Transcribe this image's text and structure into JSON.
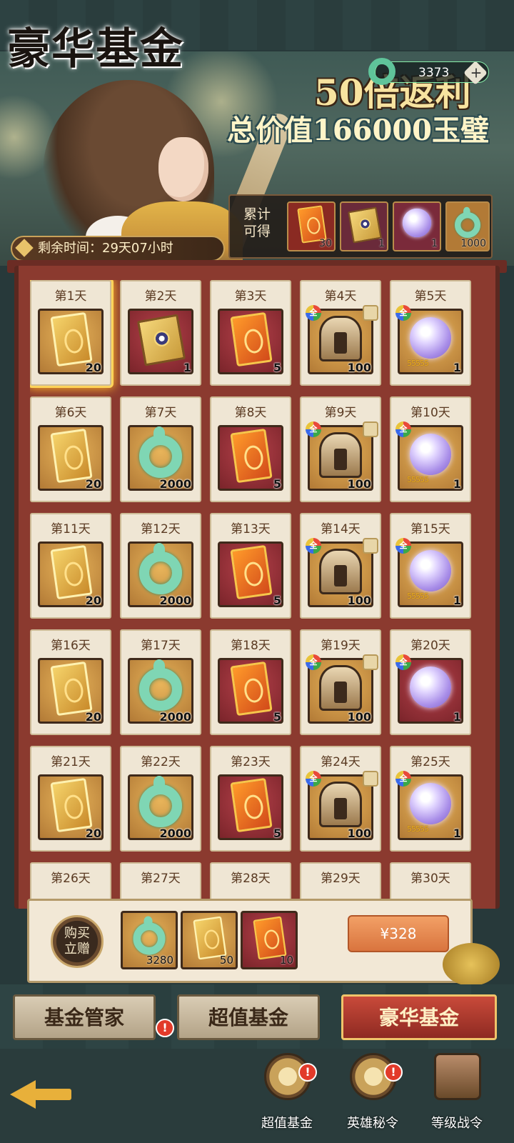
{
  "banner": {
    "title": "豪华基金",
    "subtitle_line1": "50倍返利",
    "subtitle_line2": "总价值166000玉璧",
    "currency_value": "3373",
    "remaining_time": "剩余时间：29天07小时",
    "cumulative_label_line1": "累计",
    "cumulative_label_line2": "可得",
    "cumulative_items": [
      {
        "icon": "red-token-icon",
        "count": "30"
      },
      {
        "icon": "book-icon",
        "count": "1"
      },
      {
        "icon": "purple-orb-icon",
        "count": "1"
      },
      {
        "icon": "jade-bi-icon",
        "count": "1000"
      }
    ]
  },
  "days": [
    {
      "label": "第1天",
      "type": "token-gold",
      "qty": "20"
    },
    {
      "label": "第2天",
      "type": "book",
      "qty": "1"
    },
    {
      "label": "第3天",
      "type": "token-red",
      "qty": "5"
    },
    {
      "label": "第4天",
      "type": "helmet",
      "qty": "100"
    },
    {
      "label": "第5天",
      "type": "orb",
      "qty": "1",
      "stars": "55555"
    },
    {
      "label": "第6天",
      "type": "token-gold",
      "qty": "20"
    },
    {
      "label": "第7天",
      "type": "jade",
      "qty": "2000"
    },
    {
      "label": "第8天",
      "type": "token-red",
      "qty": "5"
    },
    {
      "label": "第9天",
      "type": "helmet",
      "qty": "100"
    },
    {
      "label": "第10天",
      "type": "orb",
      "qty": "1",
      "stars": "55555"
    },
    {
      "label": "第11天",
      "type": "token-gold",
      "qty": "20"
    },
    {
      "label": "第12天",
      "type": "jade",
      "qty": "2000"
    },
    {
      "label": "第13天",
      "type": "token-red",
      "qty": "5"
    },
    {
      "label": "第14天",
      "type": "helmet",
      "qty": "100"
    },
    {
      "label": "第15天",
      "type": "orb",
      "qty": "1",
      "stars": "55555"
    },
    {
      "label": "第16天",
      "type": "token-gold",
      "qty": "20"
    },
    {
      "label": "第17天",
      "type": "jade",
      "qty": "2000"
    },
    {
      "label": "第18天",
      "type": "token-red",
      "qty": "5"
    },
    {
      "label": "第19天",
      "type": "helmet",
      "qty": "100"
    },
    {
      "label": "第20天",
      "type": "orb-red",
      "qty": "1"
    },
    {
      "label": "第21天",
      "type": "token-gold",
      "qty": "20"
    },
    {
      "label": "第22天",
      "type": "jade",
      "qty": "2000"
    },
    {
      "label": "第23天",
      "type": "token-red",
      "qty": "5"
    },
    {
      "label": "第24天",
      "type": "helmet",
      "qty": "100"
    },
    {
      "label": "第25天",
      "type": "orb",
      "qty": "1",
      "stars": "55555"
    },
    {
      "label": "第26天",
      "type": "partial",
      "qty": ""
    },
    {
      "label": "第27天",
      "type": "partial",
      "qty": ""
    },
    {
      "label": "第28天",
      "type": "partial",
      "qty": ""
    },
    {
      "label": "第29天",
      "type": "partial",
      "qty": ""
    },
    {
      "label": "第30天",
      "type": "partial",
      "qty": ""
    }
  ],
  "purchase": {
    "gift_label_line1": "购买",
    "gift_label_line2": "立赠",
    "gift_items": [
      {
        "icon": "jade-bi-icon",
        "qty": "3280"
      },
      {
        "icon": "gold-token-icon",
        "qty": "50"
      },
      {
        "icon": "red-token-icon",
        "qty": "10"
      }
    ],
    "price": "¥328"
  },
  "tabs": [
    {
      "label": "基金管家",
      "active": false,
      "alert": true
    },
    {
      "label": "超值基金",
      "active": false,
      "alert": true
    },
    {
      "label": "豪华基金",
      "active": true,
      "alert": false
    }
  ],
  "nav": [
    {
      "label": "超值基金",
      "icon": "jade-disc-icon",
      "alert": true
    },
    {
      "label": "英雄秘令",
      "icon": "dragon-disc-icon",
      "alert": true
    },
    {
      "label": "等级战令",
      "icon": "treasure-chest-icon",
      "alert": false
    }
  ],
  "alert_mark": "!",
  "colors": {
    "accent_gold": "#f0c46a",
    "active_tab": "#c94a3a",
    "board": "#8b3a2f"
  }
}
